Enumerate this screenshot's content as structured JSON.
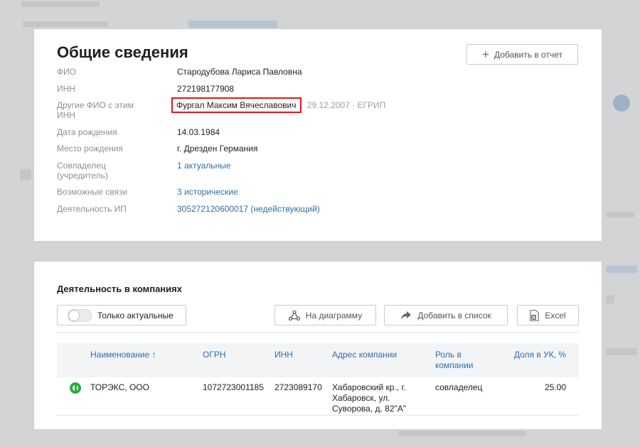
{
  "general": {
    "title": "Общие сведения",
    "add_report_label": "Добавить в отчет",
    "fields": [
      {
        "label": "ФИО",
        "value": "Стародубова Лариса Павловна"
      },
      {
        "label": "ИНН",
        "value": "272198177908"
      },
      {
        "label": "Другие ФИО с этим ИНН",
        "value": "Фургал Максим Вячеславович",
        "note": "29.12.2007 · ЕГРИП"
      },
      {
        "label": "Дата рождения",
        "value": "14.03.1984"
      },
      {
        "label": "Место рождения",
        "value": "г. Дрезден Германия"
      },
      {
        "label": "Совладелец (учредитель)",
        "value": "1 актуальные"
      },
      {
        "label": "Возможные связи",
        "value": "3 исторические"
      },
      {
        "label": "Деятельность ИП",
        "value": "305272120600017 (недействующий)"
      }
    ]
  },
  "companies": {
    "title": "Деятельность в компаниях",
    "toggle_label": "Только актуальные",
    "diagram_label": "На диаграмму",
    "add_list_label": "Добавить в список",
    "excel_label": "Excel",
    "columns": [
      "Наименование ↑",
      "ОГРН",
      "ИНН",
      "Адрес компании",
      "Роль в компании",
      "Доля в УК, %"
    ],
    "rows": [
      {
        "status_icon": "active-status-icon",
        "name": "ТОРЭКС, ООО",
        "ogrn": "1072723001185",
        "inn": "2723089170",
        "address": "Хабаровский кр., г. Хабаровск, ул. Суворова, д. 82\"А\"",
        "role": "совладелец",
        "share": "25.00"
      }
    ]
  },
  "colors": {
    "link": "#2f6fa8",
    "highlight": "#e0161b",
    "status": "#2eab3a"
  }
}
